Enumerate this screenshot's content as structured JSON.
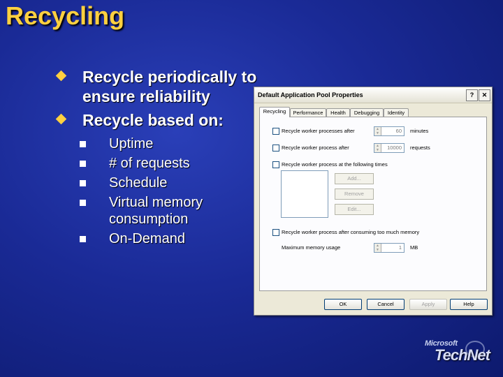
{
  "slide": {
    "title": "Recycling",
    "bullets": [
      "Recycle periodically to ensure reliability",
      "Recycle based on:"
    ],
    "subbullets": [
      "Uptime",
      "# of requests",
      "Schedule",
      "Virtual memory consumption",
      "On-Demand"
    ]
  },
  "dialog": {
    "title": "Default Application Pool Properties",
    "help_btn": "?",
    "close_btn": "✕",
    "tabs": [
      "Recycling",
      "Performance",
      "Health",
      "Debugging",
      "Identity"
    ],
    "active_tab": "Recycling",
    "options": {
      "worker_minutes": {
        "label": "Recycle worker processes after",
        "value": "60",
        "unit": "minutes"
      },
      "worker_requests": {
        "label": "Recycle worker process after",
        "value": "10000",
        "unit": "requests"
      },
      "schedule": {
        "label": "Recycle worker process at the following times"
      },
      "memory": {
        "label": "Recycle worker process after consuming too much memory"
      },
      "max_memory": {
        "label": "Maximum memory usage",
        "value": "1",
        "unit": "MB"
      }
    },
    "side_buttons": {
      "add": "Add...",
      "remove": "Remove",
      "edit": "Edit..."
    },
    "footer": {
      "ok": "OK",
      "cancel": "Cancel",
      "apply": "Apply",
      "help": "Help"
    }
  },
  "logo": {
    "top": "Microsoft",
    "main": "TechNet"
  },
  "colors": {
    "title": "#ffd040",
    "background": "#1a2a96",
    "dialog": "#ece9d8"
  }
}
